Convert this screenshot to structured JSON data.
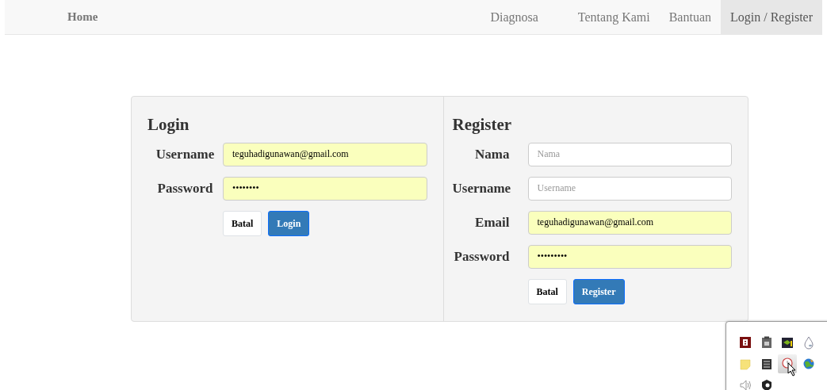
{
  "navbar": {
    "brand": "Home",
    "items": [
      {
        "label": "Diagnosa",
        "selected": false
      },
      {
        "label": "Tentang Kami",
        "selected": false
      },
      {
        "label": "Bantuan",
        "selected": false
      },
      {
        "label": "Login / Register",
        "selected": true
      }
    ]
  },
  "login": {
    "title": "Login",
    "fields": [
      {
        "label": "Username",
        "value": "teguhadigunawan@gmail.com",
        "autofilled": true
      },
      {
        "label": "Password",
        "value": "••••••••",
        "autofilled": true
      }
    ],
    "buttons": [
      {
        "label": "Batal",
        "kind": "default"
      },
      {
        "label": "Login",
        "kind": "primary"
      }
    ]
  },
  "register": {
    "title": "Register",
    "fields": [
      {
        "label": "Nama",
        "placeholder": "Nama",
        "autofilled": false
      },
      {
        "label": "Username",
        "placeholder": "Username",
        "autofilled": false
      },
      {
        "label": "Email",
        "value": "teguhadigunawan@gmail.com",
        "autofilled": true
      },
      {
        "label": "Password",
        "value": "•••••••••",
        "autofilled": true
      }
    ],
    "buttons": [
      {
        "label": "Batal",
        "kind": "default"
      },
      {
        "label": "Register",
        "kind": "primary"
      }
    ]
  },
  "tray": {
    "items": [
      {
        "highlighted": false
      },
      {
        "highlighted": false
      },
      {
        "highlighted": false
      },
      {
        "highlighted": false
      },
      {
        "highlighted": false
      },
      {
        "highlighted": false
      },
      {
        "highlighted": true
      },
      {
        "highlighted": false
      },
      {
        "highlighted": false
      },
      {
        "highlighted": false
      }
    ]
  }
}
